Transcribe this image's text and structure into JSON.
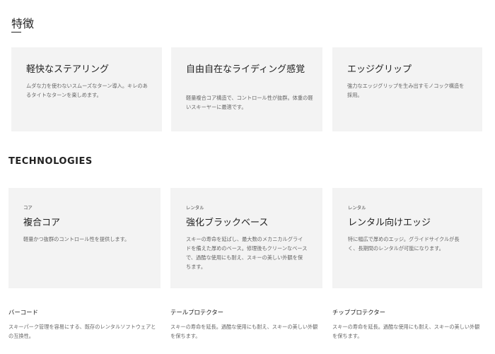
{
  "features": {
    "title": "特徴",
    "cards": [
      {
        "title": "軽快なステアリング",
        "desc": "ムダな力を使わないスムーズなターン導入。キレのあるタイトなターンを楽しめます。"
      },
      {
        "title": "自由自在なライディング感覚",
        "desc": "軽量複合コア構造で、コントロール性が抜群。体重の軽いスキーヤーに最適です。"
      },
      {
        "title": "エッジグリップ",
        "desc": "強力なエッジグリップを生み出すモノコック構造を採用。"
      }
    ]
  },
  "technologies": {
    "title": "TECHNOLOGIES",
    "cards": [
      {
        "tag": "コア",
        "title": "複合コア",
        "desc": "軽量かつ抜群のコントロール性を提供します。"
      },
      {
        "tag": "レンタル",
        "title": "強化ブラックベース",
        "desc": "スキーの寿命を延ばし、最大数のメカニカルグライドを備えた厚めのベース。修理後もクリーンなベースで、過酷な使用にも耐え、スキーの美しい外観を保ちます。"
      },
      {
        "tag": "レンタル",
        "title": "レンタル向けエッジ",
        "desc": "特に幅広で厚めのエッジ。グライドサイクルが長く、長期間のレンタルが可能になります。"
      }
    ],
    "accessories": [
      {
        "title": "バーコード",
        "desc": "スキーパーク管理を容易にする、既存のレンタルソフトウェアとの互換性。"
      },
      {
        "title": "テールプロテクター",
        "desc": "スキーの寿命を延長。過酷な使用にも耐え、スキーの美しい外観を保ちます。"
      },
      {
        "title": "チッププロテクター",
        "desc": "スキーの寿命を延長。過酷な使用にも耐え、スキーの美しい外観を保ちます。"
      }
    ]
  }
}
